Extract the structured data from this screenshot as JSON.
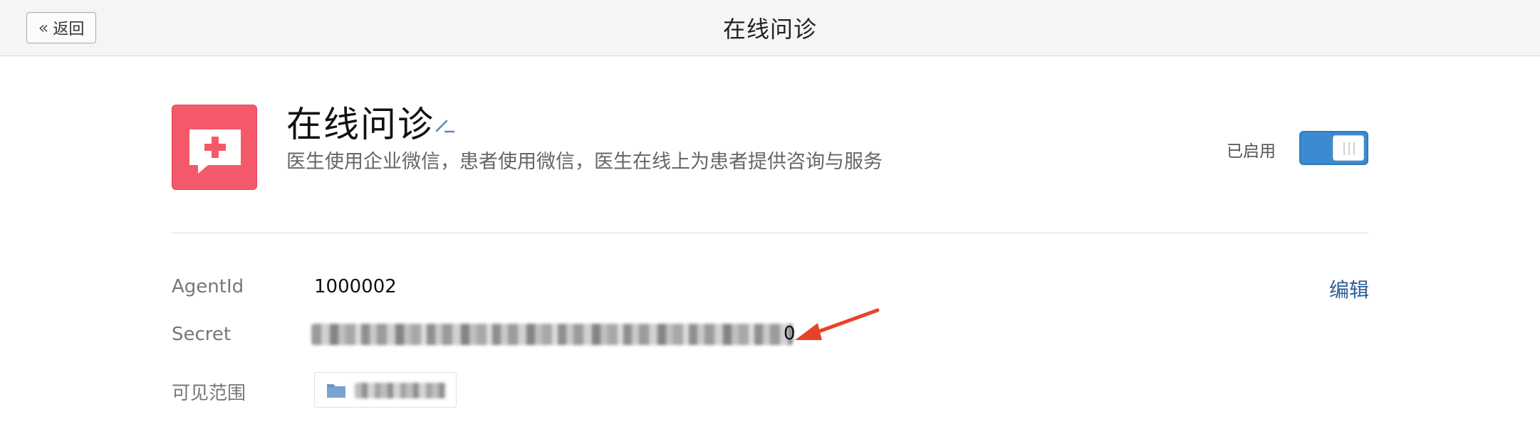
{
  "header": {
    "back_label": "返回",
    "title": "在线问诊"
  },
  "app": {
    "name": "在线问诊",
    "description": "医生使用企业微信，患者使用微信，医生在线上为患者提供咨询与服务",
    "status_label": "已启用",
    "enabled": true,
    "icon_color": "#f4596a"
  },
  "details": {
    "agentid_label": "AgentId",
    "agentid_value": "1000002",
    "edit_label": "编辑",
    "secret_label": "Secret",
    "secret_visible_tail": "0",
    "scope_label": "可见范围"
  },
  "colors": {
    "accent": "#3c8bd1",
    "link": "#2b5f99",
    "annotation_arrow": "#e8432a"
  }
}
